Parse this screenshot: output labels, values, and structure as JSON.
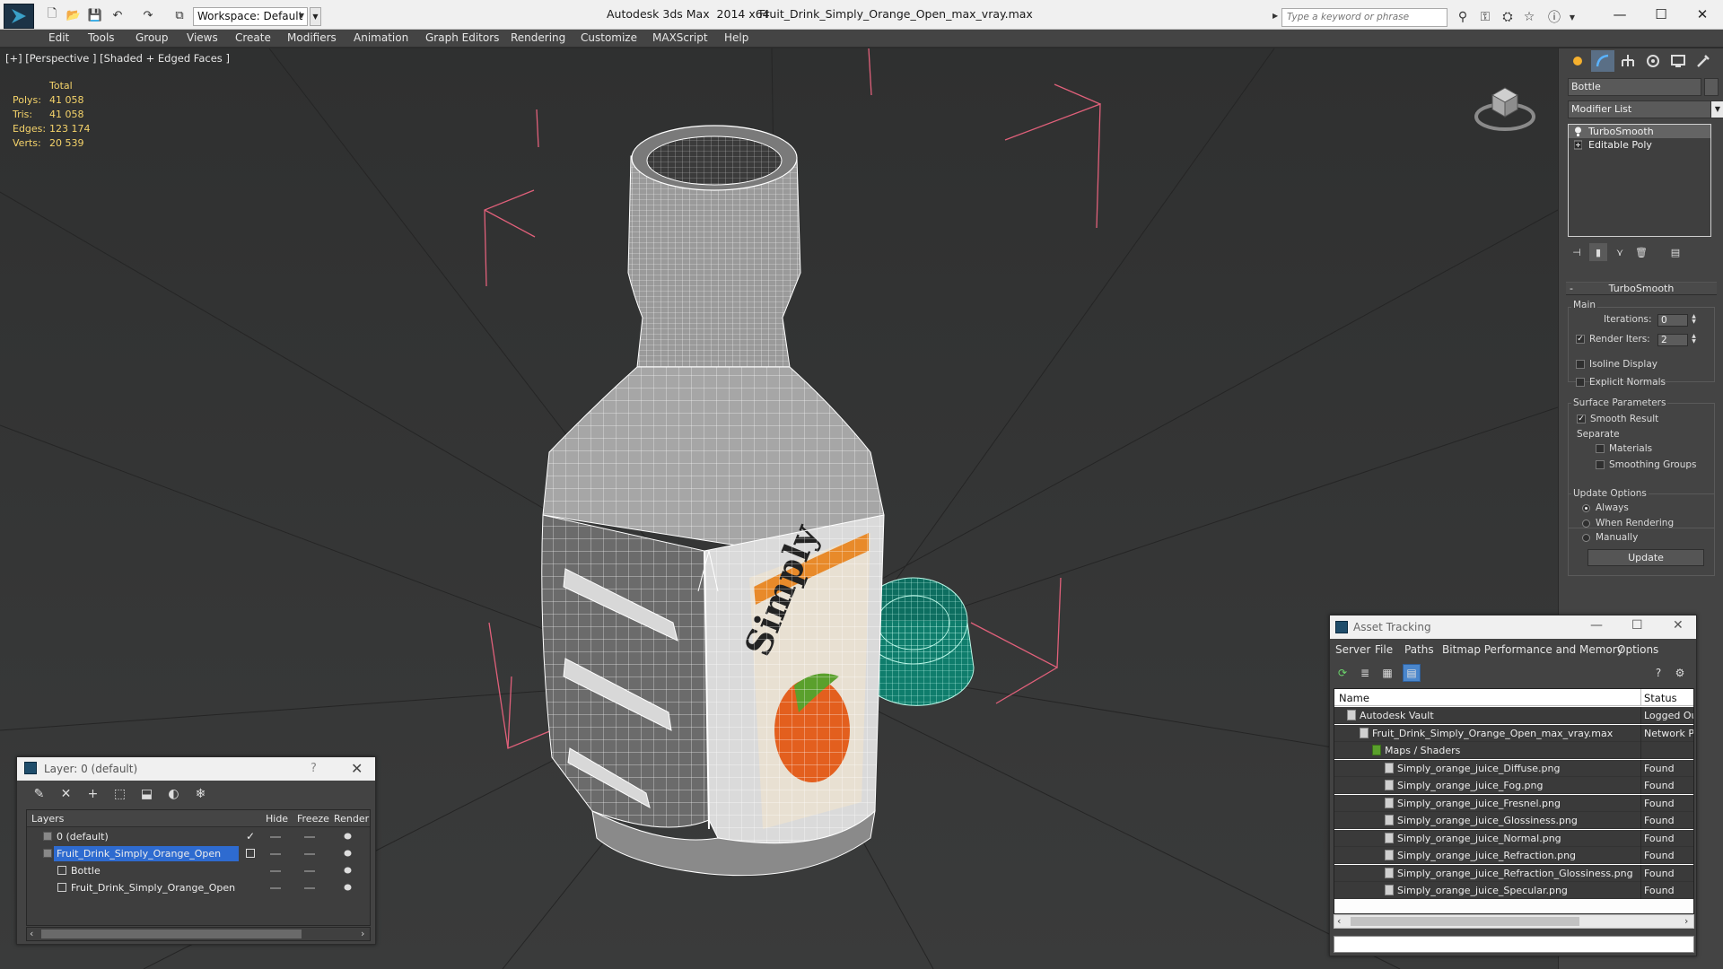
{
  "titlebar": {
    "workspace_label": "Workspace: Default",
    "app_title": "Autodesk 3ds Max  2014 x64",
    "file_title": "Fruit_Drink_Simply_Orange_Open_max_vray.max",
    "search_placeholder": "Type a keyword or phrase"
  },
  "menubar": {
    "items": [
      "Edit",
      "Tools",
      "Group",
      "Views",
      "Create",
      "Modifiers",
      "Animation",
      "Graph Editors",
      "Rendering",
      "Customize",
      "MAXScript",
      "Help"
    ]
  },
  "viewport": {
    "label": "[+] [Perspective ] [Shaded + Edged Faces ]",
    "stats": {
      "header": "Total",
      "rows": [
        {
          "label": "Polys:",
          "value": "41 058"
        },
        {
          "label": "Tris:",
          "value": "41 058"
        },
        {
          "label": "Edges:",
          "value": "123 174"
        },
        {
          "label": "Verts:",
          "value": "20 539"
        }
      ]
    }
  },
  "command_panel": {
    "object_name": "Bottle",
    "modifier_list": "Modifier List",
    "stack": [
      {
        "label": "TurboSmooth",
        "selected": true
      },
      {
        "label": "Editable Poly",
        "selected": false
      }
    ],
    "rollout_title": "TurboSmooth",
    "main_group": "Main",
    "iterations_label": "Iterations:",
    "iterations_value": "0",
    "render_iters_label": "Render Iters:",
    "render_iters_value": "2",
    "isoline_label": "Isoline Display",
    "explicit_normals_label": "Explicit Normals",
    "surface_params_group": "Surface Parameters",
    "smooth_result_label": "Smooth Result",
    "separate_label": "Separate",
    "materials_label": "Materials",
    "smoothing_groups_label": "Smoothing Groups",
    "update_options_group": "Update Options",
    "always_label": "Always",
    "when_rendering_label": "When Rendering",
    "manually_label": "Manually",
    "update_button": "Update",
    "render_iters_checked": true,
    "smooth_result_checked": true,
    "update_mode": "Always"
  },
  "layer_dialog": {
    "title": "Layer: 0 (default)",
    "help": "?",
    "columns": {
      "layers": "Layers",
      "hide": "Hide",
      "freeze": "Freeze",
      "render": "Render"
    },
    "rows": [
      {
        "name": "0 (default)",
        "indent": 0,
        "selected": false
      },
      {
        "name": "Fruit_Drink_Simply_Orange_Open",
        "indent": 0,
        "selected": true
      },
      {
        "name": "Bottle",
        "indent": 1,
        "selected": false
      },
      {
        "name": "Fruit_Drink_Simply_Orange_Open",
        "indent": 1,
        "selected": false
      }
    ]
  },
  "asset_dialog": {
    "title": "Asset Tracking",
    "menu": [
      "Server",
      "File",
      "Paths",
      "Bitmap Performance and Memory",
      "Options"
    ],
    "columns": {
      "name": "Name",
      "status": "Status"
    },
    "rows": [
      {
        "name": "Autodesk Vault",
        "status": "Logged Ou",
        "indent": 1
      },
      {
        "name": "Fruit_Drink_Simply_Orange_Open_max_vray.max",
        "status": "Network P",
        "indent": 2
      },
      {
        "name": "Maps / Shaders",
        "status": "",
        "indent": 3
      },
      {
        "name": "Simply_orange_juice_Diffuse.png",
        "status": "Found",
        "indent": 4
      },
      {
        "name": "Simply_orange_juice_Fog.png",
        "status": "Found",
        "indent": 4
      },
      {
        "name": "Simply_orange_juice_Fresnel.png",
        "status": "Found",
        "indent": 4
      },
      {
        "name": "Simply_orange_juice_Glossiness.png",
        "status": "Found",
        "indent": 4
      },
      {
        "name": "Simply_orange_juice_Normal.png",
        "status": "Found",
        "indent": 4
      },
      {
        "name": "Simply_orange_juice_Refraction.png",
        "status": "Found",
        "indent": 4
      },
      {
        "name": "Simply_orange_juice_Refraction_Glossiness.png",
        "status": "Found",
        "indent": 4
      },
      {
        "name": "Simply_orange_juice_Specular.png",
        "status": "Found",
        "indent": 4
      }
    ]
  },
  "colors": {
    "selection_blue": "#2e6bd0",
    "stats_yellow": "#f5d36a",
    "wire_white": "#ffffff",
    "cap_teal": "#1f9a86",
    "bbox_pink": "#e0607a"
  }
}
